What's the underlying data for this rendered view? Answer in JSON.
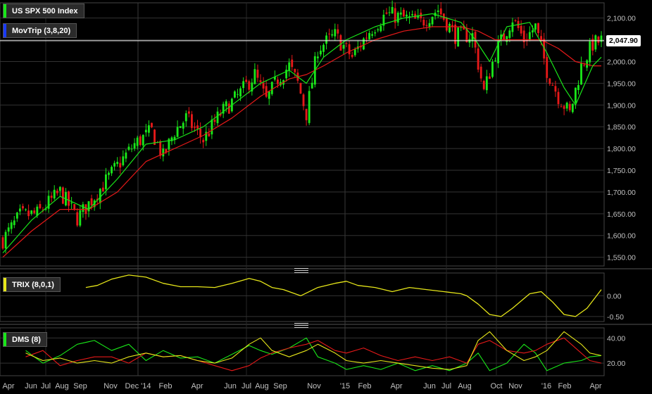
{
  "colors": {
    "up": "#19e619",
    "down": "#e61919",
    "ma_fast": "#19e619",
    "ma_slow": "#e61919",
    "trix": "#e6e619",
    "grid": "#333333",
    "text": "#c0c0c0",
    "bg": "#000000"
  },
  "legends": {
    "price": {
      "label": "US SPX 500 Index",
      "color": "#19e619"
    },
    "ma": {
      "label": "MovTrip (3,8,20)",
      "color": "#1a3aff"
    },
    "trix": {
      "label": "TRIX (8,0,1)",
      "color": "#e6e619"
    },
    "dms": {
      "label": "DMS (8)",
      "color": "#19e619"
    }
  },
  "last_value_label": "2,047.90",
  "chart_data": [
    {
      "type": "candlestick",
      "name": "price",
      "x_labels": [
        "Apr",
        "Jun",
        "Jul",
        "Aug",
        "Sep",
        "Nov",
        "Dec '14",
        "Feb",
        "Apr",
        "Jun",
        "Jul",
        "Aug",
        "Sep",
        "Nov",
        "'15",
        "Feb",
        "Apr",
        "Jun",
        "Jul",
        "Aug",
        "Oct",
        "Nov",
        "'16",
        "Feb",
        "Apr"
      ],
      "y_ticks": [
        1550,
        1600,
        1650,
        1700,
        1750,
        1800,
        1850,
        1900,
        1950,
        2000,
        2050,
        2100
      ],
      "y_tick_labels": [
        "1,550.00",
        "1,600.00",
        "1,650.00",
        "1,700.00",
        "1,750.00",
        "1,800.00",
        "1,850.00",
        "1,900.00",
        "1,950.00",
        "2,000.00",
        "2,050.00",
        "2,100.00"
      ],
      "ylim": [
        1530,
        2135
      ],
      "close_path": [
        [
          0,
          1590
        ],
        [
          6,
          1645
        ],
        [
          12,
          1650
        ],
        [
          20,
          1700
        ],
        [
          26,
          1640
        ],
        [
          32,
          1690
        ],
        [
          40,
          1760
        ],
        [
          46,
          1810
        ],
        [
          52,
          1840
        ],
        [
          56,
          1780
        ],
        [
          60,
          1840
        ],
        [
          64,
          1870
        ],
        [
          70,
          1820
        ],
        [
          76,
          1880
        ],
        [
          82,
          1920
        ],
        [
          88,
          1970
        ],
        [
          92,
          1910
        ],
        [
          96,
          1960
        ],
        [
          100,
          1990
        ],
        [
          103,
          1950
        ],
        [
          106,
          1880
        ],
        [
          110,
          2030
        ],
        [
          116,
          2060
        ],
        [
          122,
          2010
        ],
        [
          128,
          2070
        ],
        [
          134,
          2110
        ],
        [
          140,
          2100
        ],
        [
          146,
          2090
        ],
        [
          152,
          2120
        ],
        [
          158,
          2060
        ],
        [
          164,
          2060
        ],
        [
          168,
          1930
        ],
        [
          172,
          2020
        ],
        [
          178,
          2100
        ],
        [
          182,
          2050
        ],
        [
          186,
          2080
        ],
        [
          190,
          1980
        ],
        [
          194,
          1920
        ],
        [
          198,
          1880
        ],
        [
          202,
          1990
        ],
        [
          206,
          2040
        ],
        [
          209,
          2048
        ]
      ],
      "ma_fast": [
        [
          0,
          1560
        ],
        [
          10,
          1635
        ],
        [
          20,
          1690
        ],
        [
          30,
          1660
        ],
        [
          40,
          1730
        ],
        [
          50,
          1810
        ],
        [
          60,
          1820
        ],
        [
          70,
          1850
        ],
        [
          80,
          1900
        ],
        [
          90,
          1950
        ],
        [
          100,
          1980
        ],
        [
          106,
          1950
        ],
        [
          112,
          2010
        ],
        [
          120,
          2050
        ],
        [
          130,
          2080
        ],
        [
          140,
          2100
        ],
        [
          150,
          2110
        ],
        [
          160,
          2090
        ],
        [
          165,
          2050
        ],
        [
          170,
          2000
        ],
        [
          176,
          2080
        ],
        [
          184,
          2090
        ],
        [
          190,
          2020
        ],
        [
          196,
          1940
        ],
        [
          200,
          1900
        ],
        [
          206,
          1990
        ],
        [
          209,
          2010
        ]
      ],
      "ma_slow": [
        [
          0,
          1550
        ],
        [
          10,
          1610
        ],
        [
          20,
          1660
        ],
        [
          30,
          1660
        ],
        [
          40,
          1700
        ],
        [
          50,
          1770
        ],
        [
          60,
          1800
        ],
        [
          70,
          1830
        ],
        [
          80,
          1870
        ],
        [
          90,
          1920
        ],
        [
          100,
          1960
        ],
        [
          106,
          1970
        ],
        [
          112,
          1990
        ],
        [
          120,
          2020
        ],
        [
          130,
          2050
        ],
        [
          140,
          2070
        ],
        [
          150,
          2080
        ],
        [
          160,
          2080
        ],
        [
          166,
          2070
        ],
        [
          172,
          2050
        ],
        [
          180,
          2050
        ],
        [
          188,
          2050
        ],
        [
          194,
          2030
        ],
        [
          200,
          2000
        ],
        [
          206,
          1990
        ],
        [
          209,
          1990
        ]
      ]
    },
    {
      "type": "line",
      "name": "trix",
      "y_ticks": [
        0,
        -0.5
      ],
      "y_tick_labels": [
        "0.00",
        "-0.50"
      ],
      "ylim": [
        -0.62,
        0.55
      ],
      "points": [
        [
          29,
          0.2
        ],
        [
          33,
          0.25
        ],
        [
          38,
          0.4
        ],
        [
          44,
          0.5
        ],
        [
          50,
          0.45
        ],
        [
          56,
          0.3
        ],
        [
          62,
          0.22
        ],
        [
          68,
          0.22
        ],
        [
          74,
          0.2
        ],
        [
          80,
          0.3
        ],
        [
          86,
          0.42
        ],
        [
          90,
          0.35
        ],
        [
          94,
          0.2
        ],
        [
          98,
          0.15
        ],
        [
          104,
          0.0
        ],
        [
          110,
          0.2
        ],
        [
          116,
          0.3
        ],
        [
          120,
          0.35
        ],
        [
          124,
          0.25
        ],
        [
          130,
          0.2
        ],
        [
          136,
          0.1
        ],
        [
          142,
          0.2
        ],
        [
          148,
          0.15
        ],
        [
          154,
          0.1
        ],
        [
          160,
          0.05
        ],
        [
          162,
          0.0
        ],
        [
          166,
          -0.2
        ],
        [
          170,
          -0.45
        ],
        [
          174,
          -0.5
        ],
        [
          178,
          -0.3
        ],
        [
          184,
          0.05
        ],
        [
          188,
          0.1
        ],
        [
          192,
          -0.15
        ],
        [
          196,
          -0.45
        ],
        [
          200,
          -0.5
        ],
        [
          204,
          -0.3
        ],
        [
          209,
          0.15
        ]
      ]
    },
    {
      "type": "line",
      "name": "dms",
      "y_ticks": [
        40,
        20
      ],
      "y_tick_labels": [
        "40.00",
        "20.00"
      ],
      "ylim": [
        10,
        48
      ],
      "series": [
        {
          "color": "#19e619",
          "points": [
            [
              8,
              30
            ],
            [
              14,
              20
            ],
            [
              20,
              26
            ],
            [
              26,
              35
            ],
            [
              32,
              38
            ],
            [
              38,
              30
            ],
            [
              44,
              35
            ],
            [
              50,
              22
            ],
            [
              56,
              30
            ],
            [
              62,
              24
            ],
            [
              68,
              25
            ],
            [
              74,
              20
            ],
            [
              80,
              27
            ],
            [
              86,
              34
            ],
            [
              90,
              30
            ],
            [
              94,
              27
            ],
            [
              100,
              32
            ],
            [
              106,
              40
            ],
            [
              110,
              25
            ],
            [
              116,
              20
            ],
            [
              120,
              15
            ],
            [
              126,
              18
            ],
            [
              132,
              15
            ],
            [
              138,
              20
            ],
            [
              144,
              14
            ],
            [
              150,
              18
            ],
            [
              156,
              14
            ],
            [
              162,
              20
            ],
            [
              166,
              28
            ],
            [
              170,
              14
            ],
            [
              176,
              20
            ],
            [
              182,
              35
            ],
            [
              186,
              28
            ],
            [
              190,
              14
            ],
            [
              196,
              20
            ],
            [
              202,
              22
            ],
            [
              205,
              25
            ],
            [
              209,
              26
            ]
          ]
        },
        {
          "color": "#e61919",
          "points": [
            [
              8,
              25
            ],
            [
              14,
              30
            ],
            [
              20,
              18
            ],
            [
              26,
              22
            ],
            [
              32,
              25
            ],
            [
              38,
              25
            ],
            [
              44,
              20
            ],
            [
              50,
              28
            ],
            [
              56,
              25
            ],
            [
              62,
              26
            ],
            [
              68,
              22
            ],
            [
              74,
              18
            ],
            [
              80,
              14
            ],
            [
              86,
              18
            ],
            [
              90,
              24
            ],
            [
              94,
              28
            ],
            [
              100,
              32
            ],
            [
              106,
              35
            ],
            [
              110,
              38
            ],
            [
              116,
              30
            ],
            [
              120,
              28
            ],
            [
              126,
              32
            ],
            [
              132,
              26
            ],
            [
              138,
              22
            ],
            [
              144,
              25
            ],
            [
              150,
              22
            ],
            [
              156,
              25
            ],
            [
              162,
              20
            ],
            [
              166,
              35
            ],
            [
              170,
              38
            ],
            [
              176,
              30
            ],
            [
              182,
              28
            ],
            [
              186,
              30
            ],
            [
              190,
              35
            ],
            [
              196,
              40
            ],
            [
              202,
              28
            ],
            [
              205,
              22
            ],
            [
              209,
              20
            ]
          ]
        },
        {
          "color": "#e6e619",
          "points": [
            [
              8,
              28
            ],
            [
              14,
              22
            ],
            [
              20,
              24
            ],
            [
              26,
              20
            ],
            [
              32,
              22
            ],
            [
              38,
              20
            ],
            [
              44,
              25
            ],
            [
              50,
              28
            ],
            [
              56,
              25
            ],
            [
              62,
              26
            ],
            [
              68,
              22
            ],
            [
              74,
              20
            ],
            [
              80,
              24
            ],
            [
              86,
              35
            ],
            [
              90,
              40
            ],
            [
              94,
              30
            ],
            [
              100,
              25
            ],
            [
              106,
              30
            ],
            [
              110,
              35
            ],
            [
              116,
              28
            ],
            [
              120,
              22
            ],
            [
              126,
              20
            ],
            [
              132,
              22
            ],
            [
              138,
              20
            ],
            [
              144,
              18
            ],
            [
              150,
              16
            ],
            [
              156,
              15
            ],
            [
              162,
              18
            ],
            [
              166,
              38
            ],
            [
              170,
              45
            ],
            [
              176,
              30
            ],
            [
              182,
              22
            ],
            [
              186,
              25
            ],
            [
              190,
              30
            ],
            [
              196,
              45
            ],
            [
              202,
              35
            ],
            [
              205,
              28
            ],
            [
              209,
              26
            ]
          ]
        }
      ]
    }
  ]
}
